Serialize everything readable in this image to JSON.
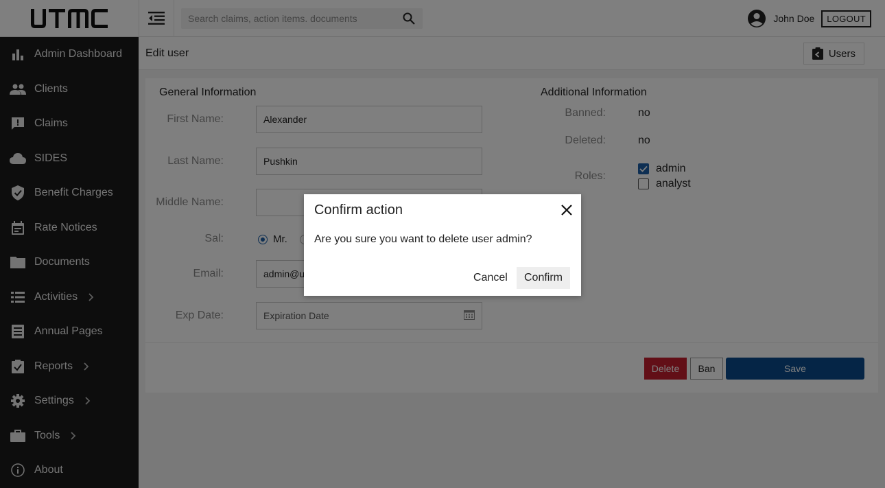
{
  "app": {
    "logo_text": "UTMC"
  },
  "topbar": {
    "search_placeholder": "Search claims, action items. documents",
    "user_name": "John Doe",
    "logout_label": "LOGOUT"
  },
  "sidebar": {
    "items": [
      {
        "label": "Admin Dashboard",
        "icon": "bar-chart-icon",
        "has_submenu": false
      },
      {
        "label": "Clients",
        "icon": "people-icon",
        "has_submenu": false
      },
      {
        "label": "Claims",
        "icon": "comment-alert-icon",
        "has_submenu": false
      },
      {
        "label": "SIDES",
        "icon": "cloud-icon",
        "has_submenu": false
      },
      {
        "label": "Benefit Charges",
        "icon": "shield-check-icon",
        "has_submenu": false
      },
      {
        "label": "Rate Notices",
        "icon": "calendar-icon",
        "has_submenu": false
      },
      {
        "label": "Documents",
        "icon": "folder-icon",
        "has_submenu": false
      },
      {
        "label": "Activities",
        "icon": "list-icon",
        "has_submenu": true
      },
      {
        "label": "Annual Pages",
        "icon": "document-icon",
        "has_submenu": false
      },
      {
        "label": "Reports",
        "icon": "clipboard-check-icon",
        "has_submenu": true
      },
      {
        "label": "Settings",
        "icon": "gear-icon",
        "has_submenu": true
      },
      {
        "label": "Tools",
        "icon": "briefcase-icon",
        "has_submenu": true
      },
      {
        "label": "About",
        "icon": "info-icon",
        "has_submenu": false
      }
    ]
  },
  "page": {
    "title": "Edit user",
    "users_button_label": "Users"
  },
  "general": {
    "heading": "General Information",
    "first_name_label": "First Name:",
    "first_name_value": "Alexander",
    "last_name_label": "Last Name:",
    "last_name_value": "Pushkin",
    "middle_name_label": "Middle Name:",
    "middle_name_value": "",
    "sal_label": "Sal:",
    "sal_option_mr": "Mr.",
    "email_label": "Email:",
    "email_value": "admin@ut",
    "exp_date_label": "Exp Date:",
    "exp_date_placeholder": "Expiration Date"
  },
  "additional": {
    "heading": "Additional Information",
    "banned_label": "Banned:",
    "banned_value": "no",
    "deleted_label": "Deleted:",
    "deleted_value": "no",
    "roles_label": "Roles:",
    "roles": [
      {
        "label": "admin",
        "checked": true
      },
      {
        "label": "analyst",
        "checked": false
      }
    ]
  },
  "actions": {
    "delete_label": "Delete",
    "ban_label": "Ban",
    "save_label": "Save"
  },
  "modal": {
    "title": "Confirm action",
    "message": "Are you sure you want to delete user admin?",
    "cancel_label": "Cancel",
    "confirm_label": "Confirm"
  },
  "colors": {
    "sidebar_bg": "#1a1a1a",
    "accent": "#1d5fa6",
    "save_button": "#0a4a8c",
    "delete_button": "#c41e2e"
  }
}
